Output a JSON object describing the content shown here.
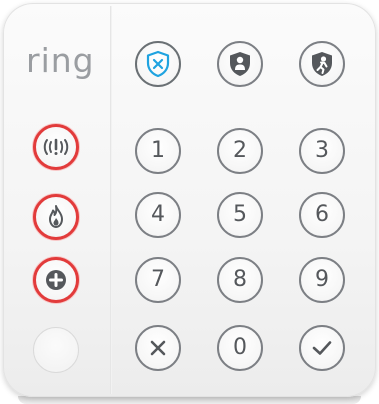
{
  "brand": {
    "logo_text": "ring"
  },
  "mode_buttons": [
    {
      "icon": "shield-x-icon"
    },
    {
      "icon": "shield-person-home-icon"
    },
    {
      "icon": "shield-person-away-icon"
    }
  ],
  "emergency_buttons": [
    {
      "icon": "police-alert-icon"
    },
    {
      "icon": "fire-icon"
    },
    {
      "icon": "medical-cross-icon"
    }
  ],
  "keypad": {
    "digits": [
      "1",
      "2",
      "3",
      "4",
      "5",
      "6",
      "7",
      "8",
      "9",
      "0"
    ],
    "cancel_icon": "x-icon",
    "confirm_icon": "checkmark-icon"
  },
  "colors": {
    "accent_blue": "#1fa3e0",
    "emergency_red": "#e23b3b",
    "icon_gray": "#55585c",
    "logo_gray": "#9a9da1"
  }
}
